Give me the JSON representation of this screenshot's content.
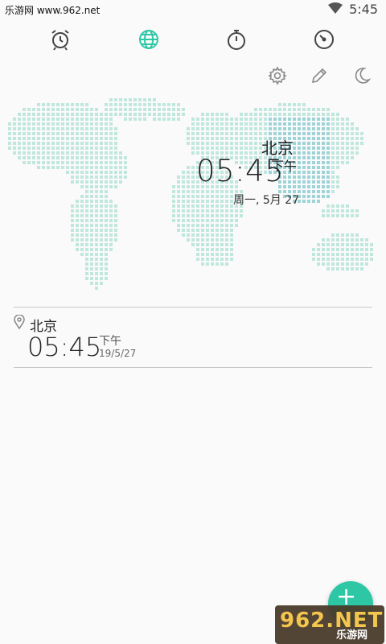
{
  "status_bar": {
    "left_text": "乐游网 www.962.net",
    "time": "5:45",
    "icons": [
      "wifi-icon",
      "battery-icon"
    ]
  },
  "tabs": [
    {
      "name": "alarm",
      "icon": "alarm-clock-icon",
      "active": false
    },
    {
      "name": "world-clock",
      "icon": "globe-icon",
      "active": true
    },
    {
      "name": "stopwatch",
      "icon": "stopwatch-icon",
      "active": false
    },
    {
      "name": "timer",
      "icon": "timer-icon",
      "active": false
    }
  ],
  "actions": [
    "settings-icon",
    "edit-icon",
    "night-mode-icon"
  ],
  "map": {
    "city": "北京",
    "time": "05:45",
    "ampm": "下午",
    "date": "周一, 5月 27"
  },
  "cities": [
    {
      "city": "北京",
      "time": "05:45",
      "ampm": "下午",
      "date": "19/5/27"
    }
  ],
  "fab": {
    "label": "+"
  },
  "watermark": {
    "main": "962.NET",
    "sub": "乐游网"
  },
  "colors": {
    "accent": "#2ec7a5",
    "map_dots": "#bfe7dd",
    "map_highlight": "#9ed3d8"
  }
}
